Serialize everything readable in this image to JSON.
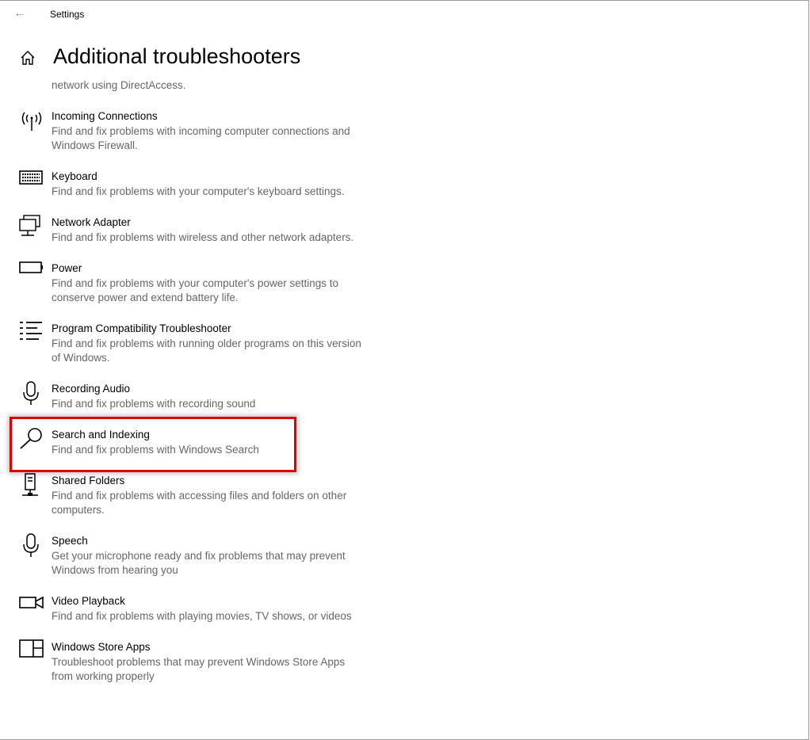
{
  "window": {
    "title": "Settings",
    "back_icon": "back-arrow-icon"
  },
  "header": {
    "title": "Additional troubleshooters",
    "home_icon": "home-icon"
  },
  "partial_item": {
    "description_tail": "network using DirectAccess."
  },
  "highlight": {
    "color": "#e00000",
    "item": "Search and Indexing"
  },
  "items": [
    {
      "icon": "antenna-icon",
      "title": "Incoming Connections",
      "description": "Find and fix problems with incoming computer connections and Windows Firewall."
    },
    {
      "icon": "keyboard-icon",
      "title": "Keyboard",
      "description": "Find and fix problems with your computer's keyboard settings."
    },
    {
      "icon": "network-adapter-icon",
      "title": "Network Adapter",
      "description": "Find and fix problems with wireless and other network adapters."
    },
    {
      "icon": "battery-icon",
      "title": "Power",
      "description": "Find and fix problems with your computer's power settings to conserve power and extend battery life."
    },
    {
      "icon": "list-icon",
      "title": "Program Compatibility Troubleshooter",
      "description": "Find and fix problems with running older programs on this version of Windows."
    },
    {
      "icon": "microphone-icon",
      "title": "Recording Audio",
      "description": "Find and fix problems with recording sound"
    },
    {
      "icon": "search-icon",
      "title": "Search and Indexing",
      "description": "Find and fix problems with Windows Search"
    },
    {
      "icon": "shared-folders-icon",
      "title": "Shared Folders",
      "description": "Find and fix problems with accessing files and folders on other computers."
    },
    {
      "icon": "microphone-icon",
      "title": "Speech",
      "description": "Get your microphone ready and fix problems that may prevent Windows from hearing you"
    },
    {
      "icon": "video-camera-icon",
      "title": "Video Playback",
      "description": "Find and fix problems with playing movies, TV shows, or videos"
    },
    {
      "icon": "store-apps-icon",
      "title": "Windows Store Apps",
      "description": "Troubleshoot problems that may prevent Windows Store Apps from working properly"
    }
  ]
}
